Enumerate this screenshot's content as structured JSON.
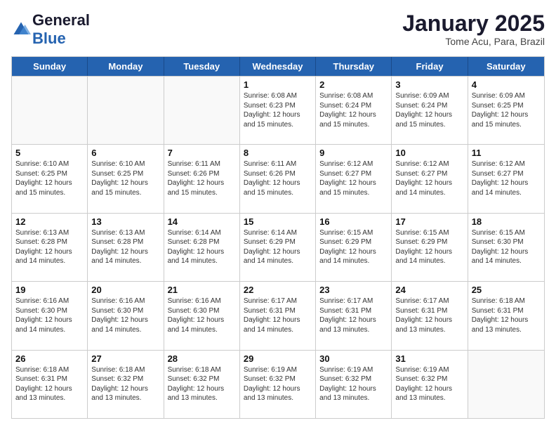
{
  "header": {
    "logo_general": "General",
    "logo_blue": "Blue",
    "title": "January 2025",
    "subtitle": "Tome Acu, Para, Brazil"
  },
  "days_of_week": [
    "Sunday",
    "Monday",
    "Tuesday",
    "Wednesday",
    "Thursday",
    "Friday",
    "Saturday"
  ],
  "weeks": [
    [
      {
        "day": "",
        "empty": true
      },
      {
        "day": "",
        "empty": true
      },
      {
        "day": "",
        "empty": true
      },
      {
        "day": "1",
        "sunrise": "6:08 AM",
        "sunset": "6:23 PM",
        "daylight": "12 hours and 15 minutes."
      },
      {
        "day": "2",
        "sunrise": "6:08 AM",
        "sunset": "6:24 PM",
        "daylight": "12 hours and 15 minutes."
      },
      {
        "day": "3",
        "sunrise": "6:09 AM",
        "sunset": "6:24 PM",
        "daylight": "12 hours and 15 minutes."
      },
      {
        "day": "4",
        "sunrise": "6:09 AM",
        "sunset": "6:25 PM",
        "daylight": "12 hours and 15 minutes."
      }
    ],
    [
      {
        "day": "5",
        "sunrise": "6:10 AM",
        "sunset": "6:25 PM",
        "daylight": "12 hours and 15 minutes."
      },
      {
        "day": "6",
        "sunrise": "6:10 AM",
        "sunset": "6:25 PM",
        "daylight": "12 hours and 15 minutes."
      },
      {
        "day": "7",
        "sunrise": "6:11 AM",
        "sunset": "6:26 PM",
        "daylight": "12 hours and 15 minutes."
      },
      {
        "day": "8",
        "sunrise": "6:11 AM",
        "sunset": "6:26 PM",
        "daylight": "12 hours and 15 minutes."
      },
      {
        "day": "9",
        "sunrise": "6:12 AM",
        "sunset": "6:27 PM",
        "daylight": "12 hours and 15 minutes."
      },
      {
        "day": "10",
        "sunrise": "6:12 AM",
        "sunset": "6:27 PM",
        "daylight": "12 hours and 14 minutes."
      },
      {
        "day": "11",
        "sunrise": "6:12 AM",
        "sunset": "6:27 PM",
        "daylight": "12 hours and 14 minutes."
      }
    ],
    [
      {
        "day": "12",
        "sunrise": "6:13 AM",
        "sunset": "6:28 PM",
        "daylight": "12 hours and 14 minutes."
      },
      {
        "day": "13",
        "sunrise": "6:13 AM",
        "sunset": "6:28 PM",
        "daylight": "12 hours and 14 minutes."
      },
      {
        "day": "14",
        "sunrise": "6:14 AM",
        "sunset": "6:28 PM",
        "daylight": "12 hours and 14 minutes."
      },
      {
        "day": "15",
        "sunrise": "6:14 AM",
        "sunset": "6:29 PM",
        "daylight": "12 hours and 14 minutes."
      },
      {
        "day": "16",
        "sunrise": "6:15 AM",
        "sunset": "6:29 PM",
        "daylight": "12 hours and 14 minutes."
      },
      {
        "day": "17",
        "sunrise": "6:15 AM",
        "sunset": "6:29 PM",
        "daylight": "12 hours and 14 minutes."
      },
      {
        "day": "18",
        "sunrise": "6:15 AM",
        "sunset": "6:30 PM",
        "daylight": "12 hours and 14 minutes."
      }
    ],
    [
      {
        "day": "19",
        "sunrise": "6:16 AM",
        "sunset": "6:30 PM",
        "daylight": "12 hours and 14 minutes."
      },
      {
        "day": "20",
        "sunrise": "6:16 AM",
        "sunset": "6:30 PM",
        "daylight": "12 hours and 14 minutes."
      },
      {
        "day": "21",
        "sunrise": "6:16 AM",
        "sunset": "6:30 PM",
        "daylight": "12 hours and 14 minutes."
      },
      {
        "day": "22",
        "sunrise": "6:17 AM",
        "sunset": "6:31 PM",
        "daylight": "12 hours and 14 minutes."
      },
      {
        "day": "23",
        "sunrise": "6:17 AM",
        "sunset": "6:31 PM",
        "daylight": "12 hours and 13 minutes."
      },
      {
        "day": "24",
        "sunrise": "6:17 AM",
        "sunset": "6:31 PM",
        "daylight": "12 hours and 13 minutes."
      },
      {
        "day": "25",
        "sunrise": "6:18 AM",
        "sunset": "6:31 PM",
        "daylight": "12 hours and 13 minutes."
      }
    ],
    [
      {
        "day": "26",
        "sunrise": "6:18 AM",
        "sunset": "6:31 PM",
        "daylight": "12 hours and 13 minutes."
      },
      {
        "day": "27",
        "sunrise": "6:18 AM",
        "sunset": "6:32 PM",
        "daylight": "12 hours and 13 minutes."
      },
      {
        "day": "28",
        "sunrise": "6:18 AM",
        "sunset": "6:32 PM",
        "daylight": "12 hours and 13 minutes."
      },
      {
        "day": "29",
        "sunrise": "6:19 AM",
        "sunset": "6:32 PM",
        "daylight": "12 hours and 13 minutes."
      },
      {
        "day": "30",
        "sunrise": "6:19 AM",
        "sunset": "6:32 PM",
        "daylight": "12 hours and 13 minutes."
      },
      {
        "day": "31",
        "sunrise": "6:19 AM",
        "sunset": "6:32 PM",
        "daylight": "12 hours and 13 minutes."
      },
      {
        "day": "",
        "empty": true
      }
    ]
  ]
}
